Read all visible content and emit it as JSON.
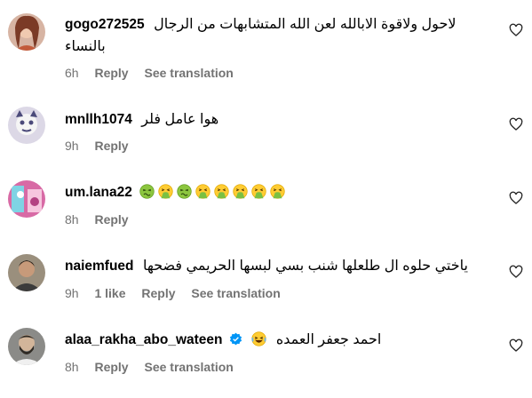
{
  "comments": [
    {
      "username": "gogo272525",
      "text": "لاحول ولاقوة الابالله لعن الله المتشابهات من الرجال",
      "text_line2": "بالنساء",
      "time": "6h",
      "reply": "Reply",
      "translate": "See translation",
      "avatar": "woman-avatar"
    },
    {
      "username": "mnllh1074",
      "text": "هوا عامل فلر",
      "time": "9h",
      "reply": "Reply",
      "avatar": "cartoon-avatar"
    },
    {
      "username": "um.lana22",
      "text": "",
      "emojis": [
        "nauseated-face",
        "vomiting-face",
        "nauseated-face",
        "vomiting-face",
        "vomiting-face",
        "vomiting-face",
        "vomiting-face",
        "vomiting-face"
      ],
      "time": "8h",
      "reply": "Reply",
      "avatar": "pink-avatar"
    },
    {
      "username": "naiemfued",
      "text": "ياختي حلوه ال طلعلها شنب بسي لبسها الحريمي فضحها",
      "time": "9h",
      "likes": "1 like",
      "reply": "Reply",
      "translate": "See translation",
      "avatar": "man-avatar"
    },
    {
      "username": "alaa_rakha_abo_wateen",
      "verified": true,
      "text": "احمد جعفر العمده",
      "emoji": "laughing-face",
      "time": "8h",
      "reply": "Reply",
      "translate": "See translation",
      "avatar": "bearded-man-avatar"
    }
  ],
  "colors": {
    "meta": "#737373",
    "verified": "#0095f6",
    "heart": "#262626"
  }
}
